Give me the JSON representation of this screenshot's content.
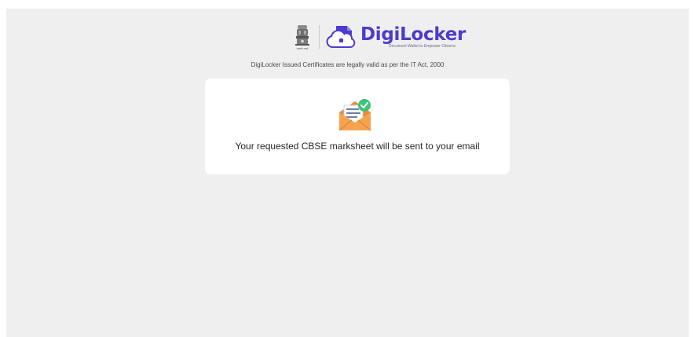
{
  "header": {
    "brand_name": "DigiLocker",
    "brand_tagline": "Document Wallet to Empower Citizens",
    "emblem_caption": "सत्यमेव जयते",
    "legal_note": "DigiLocker Issued Certificates are legally valid as per the IT Act, 2000"
  },
  "card": {
    "message": "Your requested CBSE marksheet will be sent to your email"
  },
  "colors": {
    "page_background": "#efefef",
    "brand": "#4c3bcf",
    "card_background": "#ffffff",
    "envelope": "#f5a44e",
    "check_badge": "#3cc47a"
  },
  "icons": {
    "emblem": "national-emblem-icon",
    "logo": "digilocker-logo-icon",
    "message": "envelope-check-icon"
  }
}
